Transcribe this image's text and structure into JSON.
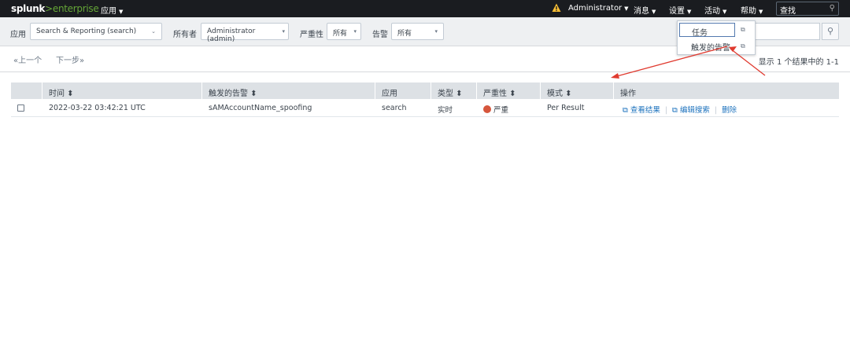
{
  "topbar": {
    "logo_main": "splunk",
    "logo_gt": ">",
    "logo_product": "enterprise",
    "apps": "应用",
    "user": "Administrator",
    "messages": "消息",
    "settings": "设置",
    "activity": "活动",
    "help": "帮助",
    "search_placeholder": "查找"
  },
  "filters": {
    "app_label": "应用",
    "app_value": "Search & Reporting (search)",
    "owner_label": "所有者",
    "owner_value": "Administrator (admin)",
    "severity_label": "严重性",
    "severity_value": "所有",
    "alert_label": "告警",
    "alert_value": "所有"
  },
  "activity_menu": {
    "items": [
      {
        "label": "任务"
      },
      {
        "label": "触发的告警"
      }
    ]
  },
  "pager": {
    "prev": "«上一个",
    "next": "下一步»",
    "count": "显示 1 个结果中的 1-1"
  },
  "table": {
    "headers": [
      "时间 ⬍",
      "触发的告警 ⬍",
      "应用",
      "类型 ⬍",
      "严重性 ⬍",
      "模式 ⬍",
      "操作"
    ],
    "rows": [
      {
        "time": "2022-03-22 03:42:21 UTC",
        "alert": "sAMAccountName_spoofing",
        "app": "search",
        "type": "实时",
        "severity": "严重",
        "mode": "Per Result",
        "actions": [
          "查看结果",
          "编辑搜索",
          "删除"
        ]
      }
    ]
  },
  "colors": {
    "topbar": "#1a1c20",
    "brand_green": "#65a637",
    "link_blue": "#1e73be",
    "severity_critical": "#d6563c",
    "annotation_red": "#e03a2f"
  }
}
